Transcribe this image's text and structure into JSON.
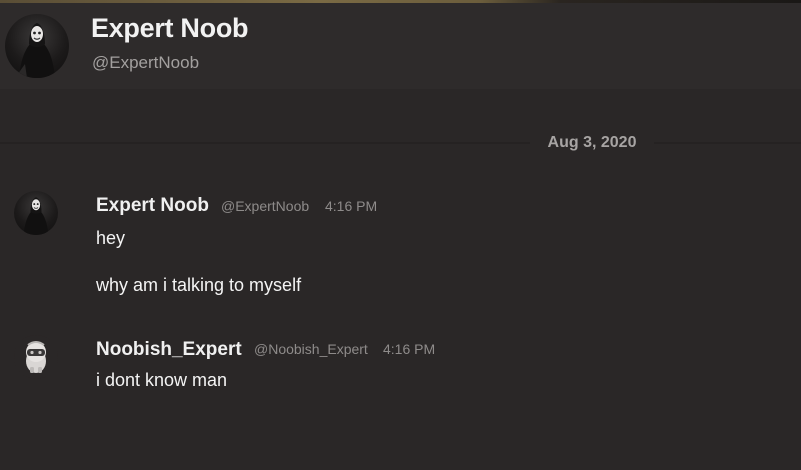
{
  "header": {
    "name": "Expert Noob",
    "handle": "@ExpertNoob"
  },
  "date_separator": "Aug 3, 2020",
  "messages": [
    {
      "author": "Expert Noob",
      "handle": "@ExpertNoob",
      "time": "4:16 PM",
      "lines": [
        "hey",
        "why am i talking to myself"
      ]
    },
    {
      "author": "Noobish_Expert",
      "handle": "@Noobish_Expert",
      "time": "4:16 PM",
      "lines": [
        "i dont know man"
      ]
    }
  ],
  "icons": {
    "header_avatar": "hooded-figure-avatar-icon",
    "user1_avatar": "hooded-figure-avatar-icon",
    "user2_avatar": "robot-character-avatar-icon"
  }
}
